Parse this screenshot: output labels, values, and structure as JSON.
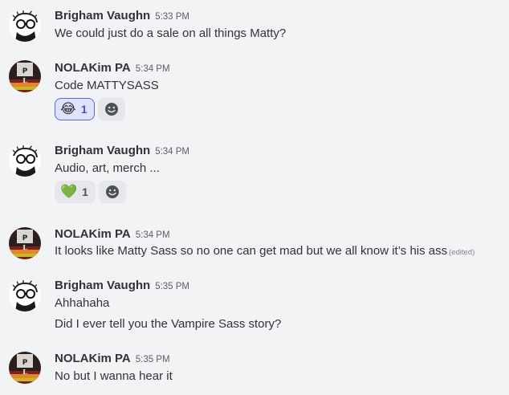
{
  "messages": [
    {
      "author": "Brigham Vaughn",
      "avatar": "sketch-face-avatar",
      "time": "5:33 PM",
      "lines": [
        "We could just do a sale on all things Matty?"
      ]
    },
    {
      "author": "NOLAKim PA",
      "avatar": "book-cover-avatar",
      "time": "5:34 PM",
      "lines": [
        "Code MATTYSASS"
      ],
      "reactions": [
        {
          "emoji": "😂",
          "count": "1",
          "selected": true
        }
      ]
    },
    {
      "author": "Brigham Vaughn",
      "avatar": "sketch-face-avatar",
      "time": "5:34 PM",
      "lines": [
        "Audio, art, merch ..."
      ],
      "reactions": [
        {
          "emoji": "💚",
          "count": "1",
          "selected": false
        }
      ]
    },
    {
      "author": "NOLAKim PA",
      "avatar": "book-cover-avatar",
      "time": "5:34 PM",
      "lines": [
        "It looks like Matty Sass so no one can get mad but we all know it’s his ass"
      ],
      "edited": "(edited)"
    },
    {
      "author": "Brigham Vaughn",
      "avatar": "sketch-face-avatar",
      "time": "5:35 PM",
      "lines": [
        "Ahhahaha",
        "Did I ever tell you the Vampire Sass story?"
      ]
    },
    {
      "author": "NOLAKim PA",
      "avatar": "book-cover-avatar",
      "time": "5:35 PM",
      "lines": [
        "No but I wanna hear it"
      ]
    }
  ],
  "colors": {
    "background": "#f2f3f5",
    "reaction_selected_border": "#5865f2",
    "reaction_selected_bg": "#e0e3fc"
  }
}
